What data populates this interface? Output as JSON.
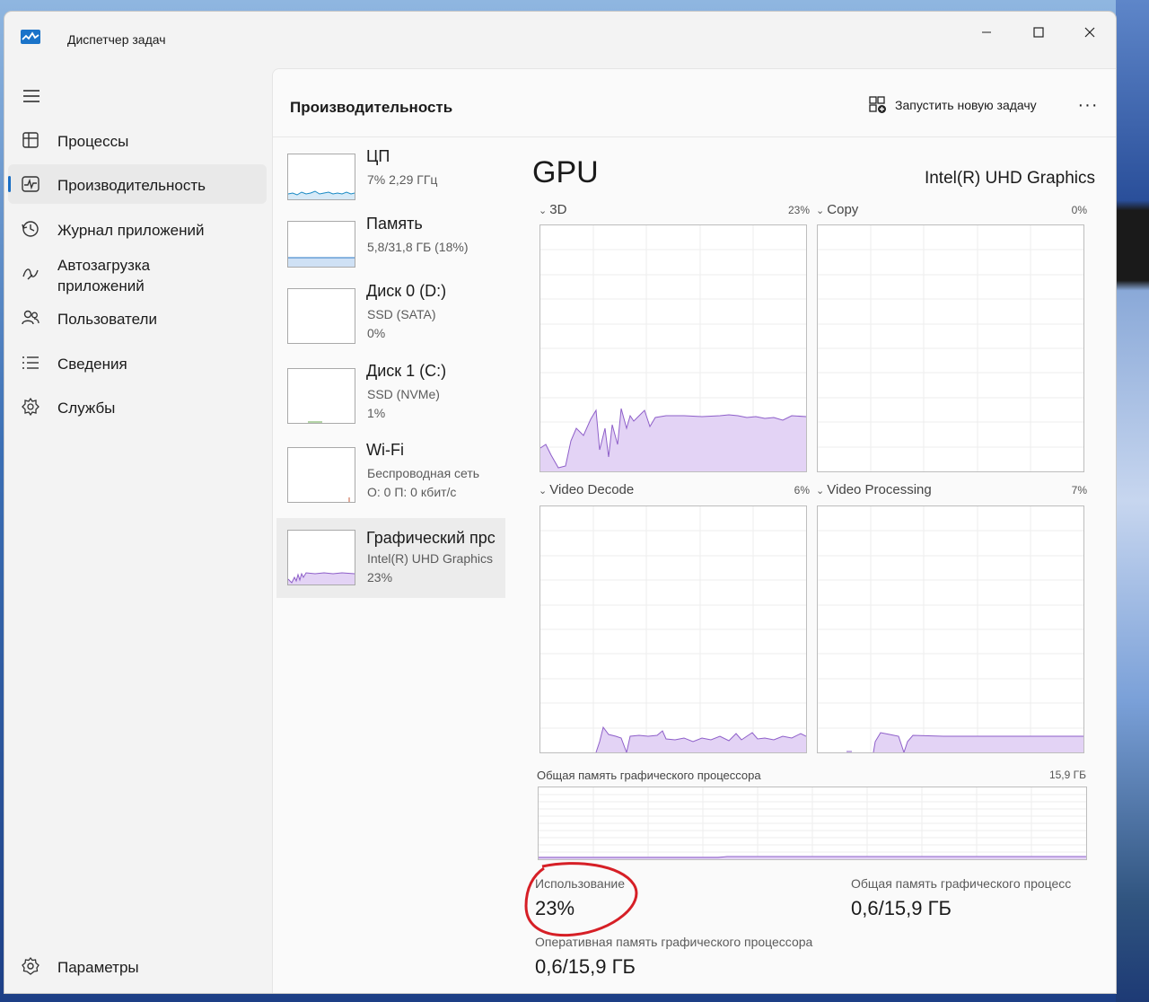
{
  "window": {
    "title": "Диспетчер задач"
  },
  "sidebar": {
    "items": [
      {
        "label": "Процессы",
        "icon": "processes-icon"
      },
      {
        "label": "Производительность",
        "icon": "performance-icon",
        "selected": true
      },
      {
        "label": "Журнал приложений",
        "icon": "history-icon"
      },
      {
        "label": "Автозагрузка\nприложений",
        "icon": "startup-icon"
      },
      {
        "label": "Пользователи",
        "icon": "users-icon"
      },
      {
        "label": "Сведения",
        "icon": "details-icon"
      },
      {
        "label": "Службы",
        "icon": "services-icon"
      }
    ],
    "settings_label": "Параметры"
  },
  "header": {
    "title": "Производительность",
    "run_task_label": "Запустить новую задачу",
    "more_label": "···"
  },
  "resources": [
    {
      "name": "ЦП",
      "sub1": "7% 2,29 ГГц",
      "sub2": ""
    },
    {
      "name": "Память",
      "sub1": "5,8/31,8 ГБ (18%)",
      "sub2": ""
    },
    {
      "name": "Диск 0 (D:)",
      "sub1": "SSD (SATA)",
      "sub2": "0%"
    },
    {
      "name": "Диск 1 (C:)",
      "sub1": "SSD (NVMe)",
      "sub2": "1%"
    },
    {
      "name": "Wi-Fi",
      "sub1": "Беспроводная сеть",
      "sub2": "О: 0 П: 0 кбит/с"
    },
    {
      "name": "Графический прс",
      "sub1": "Intel(R) UHD Graphics",
      "sub2": "23%",
      "selected": true
    }
  ],
  "detail": {
    "heading": "GPU",
    "model": "Intel(R) UHD Graphics",
    "engines": [
      {
        "label": "3D",
        "percent": "23%"
      },
      {
        "label": "Copy",
        "percent": "0%"
      },
      {
        "label": "Video Decode",
        "percent": "6%"
      },
      {
        "label": "Video Processing",
        "percent": "7%"
      }
    ],
    "shared_mem_graph_label": "Общая память графического процессора",
    "shared_mem_graph_max": "15,9 ГБ",
    "stats": {
      "usage_label": "Использование",
      "usage_value": "23%",
      "shared_label": "Общая память графического процесс",
      "shared_value": "0,6/15,9 ГБ",
      "dedicated_label": "Оперативная память графического процессора",
      "dedicated_value": "0,6/15,9 ГБ"
    }
  },
  "colors": {
    "gpu_line": "#8e5fc9",
    "gpu_fill": "#e3d3f5",
    "accent": "#1a6ec4",
    "annotation": "#d61f26"
  }
}
